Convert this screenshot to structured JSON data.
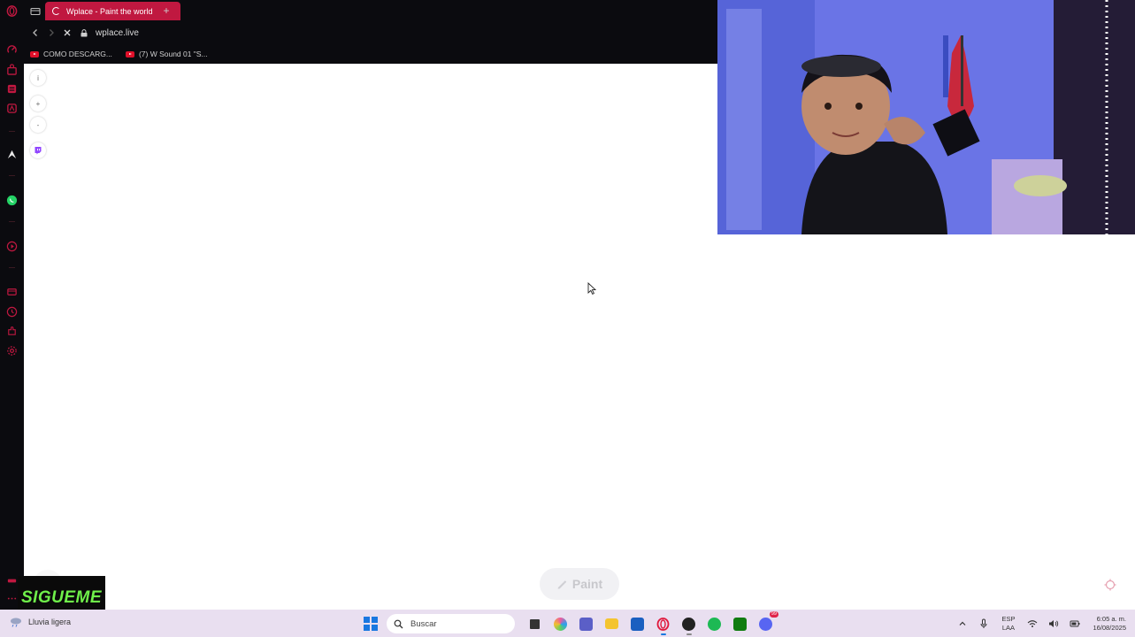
{
  "browser": {
    "tab_title": "Wplace - Paint the world",
    "new_tab_label": "+",
    "url": "wplace.live",
    "bookmarks": [
      {
        "label": "COMO DESCARG..."
      },
      {
        "label": "(7) W Sound 01 \"S..."
      }
    ]
  },
  "page": {
    "info_label": "i",
    "zoom_in_label": "+",
    "zoom_out_label": "-",
    "paint_label": "Paint"
  },
  "overlay": {
    "sigueme_label": "SIGUEME"
  },
  "taskbar": {
    "weather": "Lluvia ligera",
    "search_placeholder": "Buscar",
    "lang_line1": "ESP",
    "lang_line2": "LAA",
    "time": "6:05 a. m.",
    "date": "16/08/2025",
    "discord_badge": "99"
  },
  "colors": {
    "accent": "#c01840",
    "sidebar_bg": "#0b0b0f",
    "taskbar_bg": "#e9dff0"
  }
}
